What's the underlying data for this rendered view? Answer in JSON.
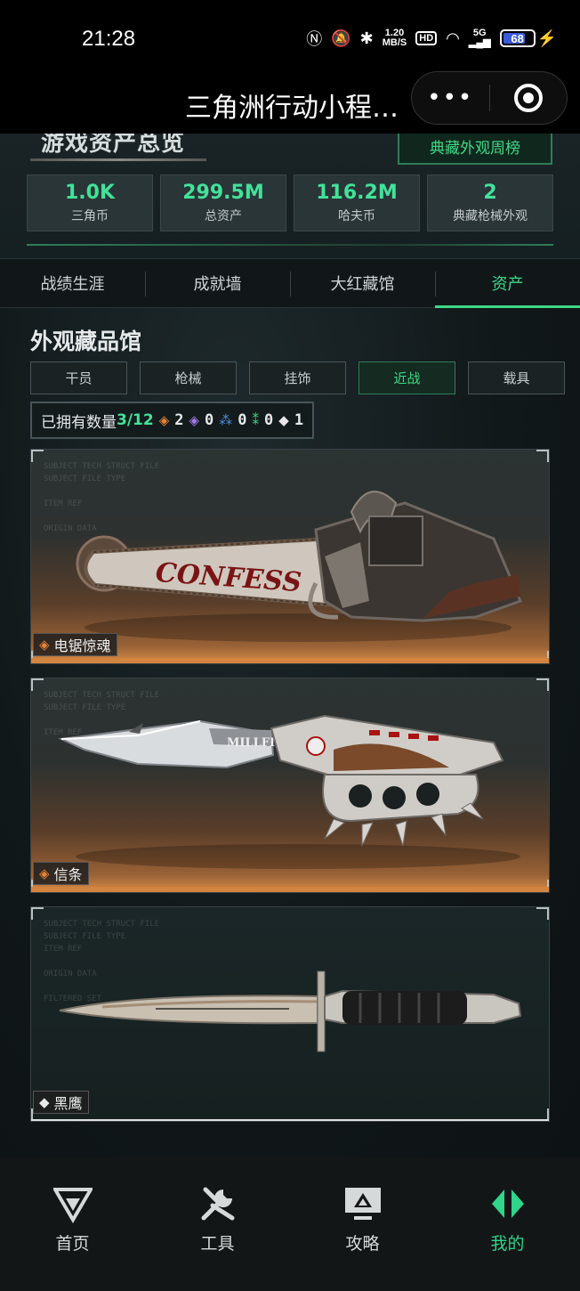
{
  "status_bar": {
    "time": "21:28",
    "net_speed_top": "1.20",
    "net_speed_unit": "MB/S",
    "hd_label": "HD",
    "signal_label": "5G",
    "battery": "68"
  },
  "title_bar": {
    "title": "三角洲行动小程…",
    "more_label": "•••"
  },
  "overview": {
    "title": "游戏资产总览",
    "weekly_button": "典藏外观周榜",
    "stats": [
      {
        "value": "1.0K",
        "label": "三角币"
      },
      {
        "value": "299.5M",
        "label": "总资产"
      },
      {
        "value": "116.2M",
        "label": "哈夫币"
      },
      {
        "value": "2",
        "label": "典藏枪械外观"
      }
    ]
  },
  "tabs": [
    {
      "label": "战绩生涯",
      "active": false
    },
    {
      "label": "成就墙",
      "active": false
    },
    {
      "label": "大红藏馆",
      "active": false
    },
    {
      "label": "资产",
      "active": true
    }
  ],
  "gallery": {
    "title": "外观藏品馆",
    "filters": [
      {
        "label": "干员",
        "active": false
      },
      {
        "label": "枪械",
        "active": false
      },
      {
        "label": "挂饰",
        "active": false
      },
      {
        "label": "近战",
        "active": true
      },
      {
        "label": "载具",
        "active": false
      }
    ],
    "owned_label": "已拥有数量",
    "owned_count": "3/12",
    "rarity_counts": [
      {
        "icon": "orange-diamond-icon",
        "color": "#e9843a",
        "count": "2"
      },
      {
        "icon": "purple-diamond-icon",
        "color": "#a47ae8",
        "count": "0"
      },
      {
        "icon": "blue-diamond-icon",
        "color": "#4c8fe0",
        "count": "0"
      },
      {
        "icon": "green-diamond-icon",
        "color": "#3ed987",
        "count": "0"
      },
      {
        "icon": "white-diamond-icon",
        "color": "#e8e8e8",
        "count": "1"
      }
    ],
    "items": [
      {
        "name": "电锯惊魂",
        "rarity_color": "#e9843a",
        "art_text": "CONFESS"
      },
      {
        "name": "信条",
        "rarity_color": "#e9843a",
        "art_text": "MILLFIELD"
      },
      {
        "name": "黑鹰",
        "rarity_color": "#e8e8e8"
      }
    ]
  },
  "bottom_nav": [
    {
      "label": "首页",
      "icon": "home-v-logo-icon",
      "active": false
    },
    {
      "label": "工具",
      "icon": "tools-icon",
      "active": false
    },
    {
      "label": "攻略",
      "icon": "guide-monitor-icon",
      "active": false
    },
    {
      "label": "我的",
      "icon": "profile-logo-icon",
      "active": true
    }
  ],
  "colors": {
    "accent_green": "#3ed987",
    "gold_bar": "#d3843f"
  }
}
